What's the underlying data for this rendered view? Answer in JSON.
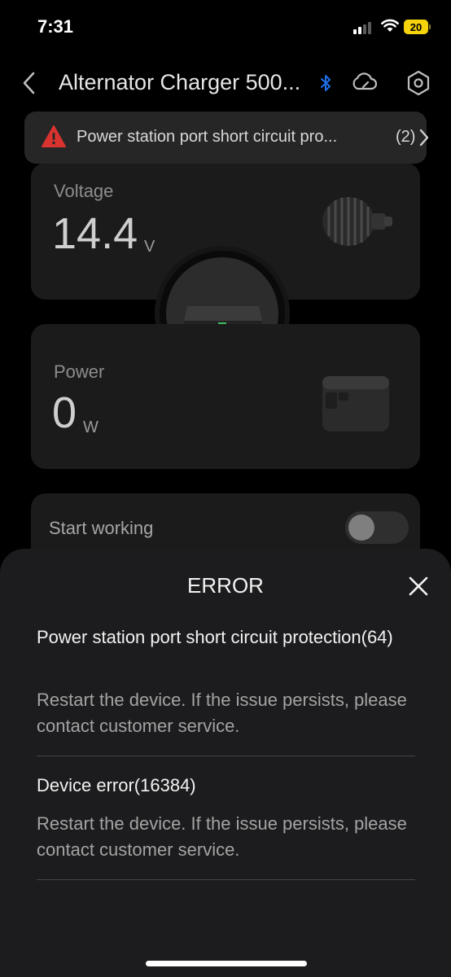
{
  "status_bar": {
    "time": "7:31",
    "battery_level": "20",
    "battery_color": "#f5d20b"
  },
  "header": {
    "title": "Alternator Charger 500...",
    "back_icon": "chevron-left-icon",
    "bluetooth_icon": "bluetooth-icon",
    "cloud_icon": "cloud-sync-icon",
    "settings_icon": "hexagon-settings-icon",
    "bluetooth_color": "#1f6feb"
  },
  "alert": {
    "icon": "warning-triangle-icon",
    "icon_color": "#e53935",
    "text": "Power station port short circuit pro...",
    "count": "(2)"
  },
  "voltage": {
    "label": "Voltage",
    "value": "14.4",
    "unit": "V"
  },
  "power": {
    "label": "Power",
    "value": "0",
    "unit": "W"
  },
  "work": {
    "label": "Start working",
    "toggle_on": false
  },
  "error_sheet": {
    "title": "ERROR",
    "errors": [
      {
        "title": "Power station port short circuit protection(64)",
        "description": "Restart the device. If the issue persists, please contact customer service."
      },
      {
        "title": "Device error(16384)",
        "description": "Restart the device. If the issue persists, please contact customer service."
      }
    ]
  }
}
